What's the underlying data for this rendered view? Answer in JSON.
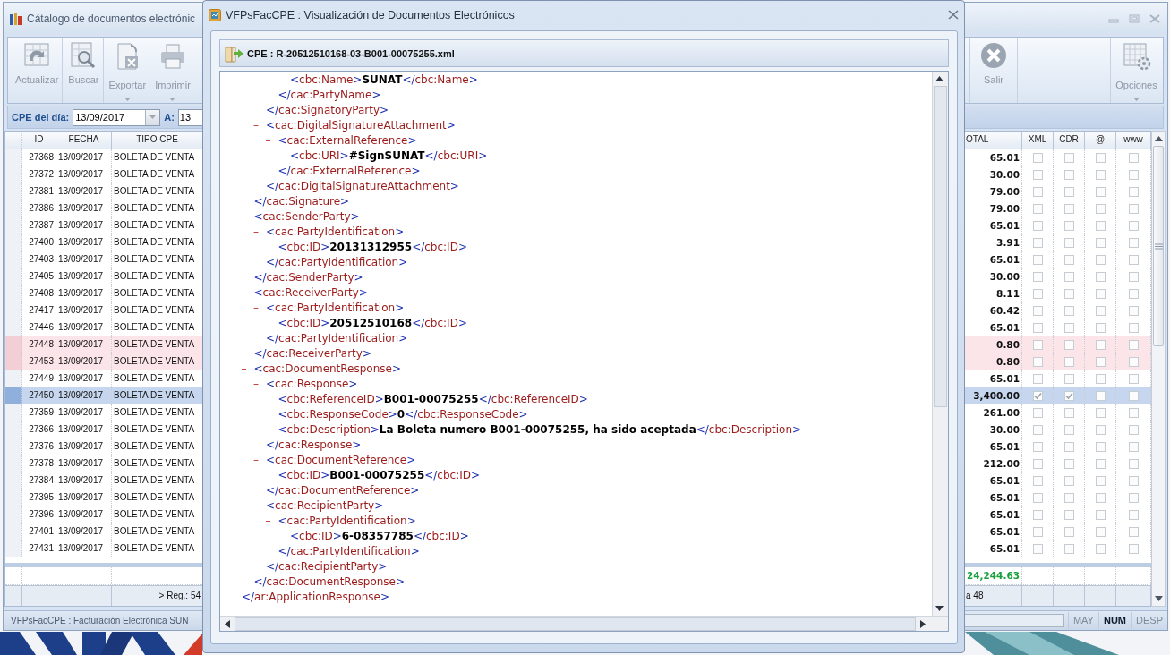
{
  "main_window": {
    "title": "Cátalogo de documentos electrónic",
    "toolbar_left": [
      {
        "label": "Actualizar",
        "kind": "refresh",
        "dropdown": false
      },
      {
        "label": "Buscar",
        "kind": "search",
        "dropdown": false
      },
      {
        "label": "Exportar",
        "kind": "export",
        "dropdown": true
      },
      {
        "label": "Imprimir",
        "kind": "print",
        "dropdown": true
      }
    ],
    "toolbar_right": [
      {
        "label": "Salir",
        "kind": "exit",
        "dropdown": false
      },
      {
        "label": "Opciones",
        "kind": "options",
        "dropdown": true
      }
    ],
    "filter": {
      "label": "CPE del día:",
      "date_from": "13/09/2017",
      "to_label": "A:",
      "date_to": "13"
    },
    "table": {
      "columns_left": [
        "ID",
        "FECHA",
        "TIPO CPE"
      ],
      "columns_right": [
        "OTAL",
        "XML",
        "CDR",
        "@",
        "www"
      ],
      "rows": [
        {
          "id": "27368",
          "date": "13/09/2017",
          "type": "BOLETA DE VENTA",
          "total": "65.01",
          "xml": false,
          "cdr": false,
          "email": false,
          "web": false,
          "selected": false,
          "flagged": false
        },
        {
          "id": "27372",
          "date": "13/09/2017",
          "type": "BOLETA DE VENTA",
          "total": "30.00",
          "xml": false,
          "cdr": false,
          "email": false,
          "web": false,
          "selected": false,
          "flagged": false
        },
        {
          "id": "27381",
          "date": "13/09/2017",
          "type": "BOLETA DE VENTA",
          "total": "79.00",
          "xml": false,
          "cdr": false,
          "email": false,
          "web": false,
          "selected": false,
          "flagged": false
        },
        {
          "id": "27386",
          "date": "13/09/2017",
          "type": "BOLETA DE VENTA",
          "total": "79.00",
          "xml": false,
          "cdr": false,
          "email": false,
          "web": false,
          "selected": false,
          "flagged": false
        },
        {
          "id": "27387",
          "date": "13/09/2017",
          "type": "BOLETA DE VENTA",
          "total": "65.01",
          "xml": false,
          "cdr": false,
          "email": false,
          "web": false,
          "selected": false,
          "flagged": false
        },
        {
          "id": "27400",
          "date": "13/09/2017",
          "type": "BOLETA DE VENTA",
          "total": "3.91",
          "xml": false,
          "cdr": false,
          "email": false,
          "web": false,
          "selected": false,
          "flagged": false
        },
        {
          "id": "27403",
          "date": "13/09/2017",
          "type": "BOLETA DE VENTA",
          "total": "65.01",
          "xml": false,
          "cdr": false,
          "email": false,
          "web": false,
          "selected": false,
          "flagged": false
        },
        {
          "id": "27405",
          "date": "13/09/2017",
          "type": "BOLETA DE VENTA",
          "total": "30.00",
          "xml": false,
          "cdr": false,
          "email": false,
          "web": false,
          "selected": false,
          "flagged": false
        },
        {
          "id": "27408",
          "date": "13/09/2017",
          "type": "BOLETA DE VENTA",
          "total": "8.11",
          "xml": false,
          "cdr": false,
          "email": false,
          "web": false,
          "selected": false,
          "flagged": false
        },
        {
          "id": "27417",
          "date": "13/09/2017",
          "type": "BOLETA DE VENTA",
          "total": "60.42",
          "xml": false,
          "cdr": false,
          "email": false,
          "web": false,
          "selected": false,
          "flagged": false
        },
        {
          "id": "27446",
          "date": "13/09/2017",
          "type": "BOLETA DE VENTA",
          "total": "65.01",
          "xml": false,
          "cdr": false,
          "email": false,
          "web": false,
          "selected": false,
          "flagged": false
        },
        {
          "id": "27448",
          "date": "13/09/2017",
          "type": "BOLETA DE VENTA",
          "total": "0.80",
          "xml": false,
          "cdr": false,
          "email": false,
          "web": false,
          "selected": false,
          "flagged": true
        },
        {
          "id": "27453",
          "date": "13/09/2017",
          "type": "BOLETA DE VENTA",
          "total": "0.80",
          "xml": false,
          "cdr": false,
          "email": false,
          "web": false,
          "selected": false,
          "flagged": true
        },
        {
          "id": "27449",
          "date": "13/09/2017",
          "type": "BOLETA DE VENTA",
          "total": "65.01",
          "xml": false,
          "cdr": false,
          "email": false,
          "web": false,
          "selected": false,
          "flagged": false
        },
        {
          "id": "27450",
          "date": "13/09/2017",
          "type": "BOLETA DE VENTA",
          "total": "3,400.00",
          "xml": true,
          "cdr": true,
          "email": false,
          "web": false,
          "selected": true,
          "flagged": false
        },
        {
          "id": "27359",
          "date": "13/09/2017",
          "type": "BOLETA DE VENTA",
          "total": "261.00",
          "xml": false,
          "cdr": false,
          "email": false,
          "web": false,
          "selected": false,
          "flagged": false
        },
        {
          "id": "27366",
          "date": "13/09/2017",
          "type": "BOLETA DE VENTA",
          "total": "30.00",
          "xml": false,
          "cdr": false,
          "email": false,
          "web": false,
          "selected": false,
          "flagged": false
        },
        {
          "id": "27376",
          "date": "13/09/2017",
          "type": "BOLETA DE VENTA",
          "total": "65.01",
          "xml": false,
          "cdr": false,
          "email": false,
          "web": false,
          "selected": false,
          "flagged": false
        },
        {
          "id": "27378",
          "date": "13/09/2017",
          "type": "BOLETA DE VENTA",
          "total": "212.00",
          "xml": false,
          "cdr": false,
          "email": false,
          "web": false,
          "selected": false,
          "flagged": false
        },
        {
          "id": "27384",
          "date": "13/09/2017",
          "type": "BOLETA DE VENTA",
          "total": "65.01",
          "xml": false,
          "cdr": false,
          "email": false,
          "web": false,
          "selected": false,
          "flagged": false
        },
        {
          "id": "27395",
          "date": "13/09/2017",
          "type": "BOLETA DE VENTA",
          "total": "65.01",
          "xml": false,
          "cdr": false,
          "email": false,
          "web": false,
          "selected": false,
          "flagged": false
        },
        {
          "id": "27396",
          "date": "13/09/2017",
          "type": "BOLETA DE VENTA",
          "total": "65.01",
          "xml": false,
          "cdr": false,
          "email": false,
          "web": false,
          "selected": false,
          "flagged": false
        },
        {
          "id": "27401",
          "date": "13/09/2017",
          "type": "BOLETA DE VENTA",
          "total": "65.01",
          "xml": false,
          "cdr": false,
          "email": false,
          "web": false,
          "selected": false,
          "flagged": false
        },
        {
          "id": "27431",
          "date": "13/09/2017",
          "type": "BOLETA DE VENTA",
          "total": "65.01",
          "xml": false,
          "cdr": false,
          "email": false,
          "web": false,
          "selected": false,
          "flagged": false
        }
      ],
      "sum_total": "24,244.63",
      "footer_records": "> Reg.: 54",
      "footer_right": "a 48"
    },
    "status_bar": {
      "text": "VFPsFacCPE : Facturación Electrónica SUN",
      "indicators": [
        {
          "label": "MAY",
          "on": false
        },
        {
          "label": "NUM",
          "on": true
        },
        {
          "label": "DESP",
          "on": false
        }
      ]
    }
  },
  "dialog": {
    "title": "VFPsFacCPE : Visualización de Documentos Electrónicos",
    "file": "CPE : R-20512510168-03-B001-00075255.xml",
    "xml": {
      "kind": "element",
      "close": "</ar:ApplicationResponse>",
      "children": [
        {
          "kind": "element",
          "close": "</cac:Signature>",
          "children": [
            {
              "kind": "element",
              "close": "</cac:SignatoryParty>",
              "children": [
                {
                  "kind": "element",
                  "close": "</cac:PartyName>",
                  "children": [
                    {
                      "kind": "leaf",
                      "open": "<cbc:Name>",
                      "value": "SUNAT",
                      "close": "</cbc:Name>"
                    }
                  ]
                }
              ]
            },
            {
              "kind": "element",
              "toggle": "–",
              "open": "<cac:DigitalSignatureAttachment>",
              "close": "</cac:DigitalSignatureAttachment>",
              "children": [
                {
                  "kind": "element",
                  "toggle": "–",
                  "open": "<cac:ExternalReference>",
                  "close": "</cac:ExternalReference>",
                  "children": [
                    {
                      "kind": "leaf",
                      "open": "<cbc:URI>",
                      "value": "#SignSUNAT",
                      "close": "</cbc:URI>"
                    }
                  ]
                }
              ]
            }
          ]
        },
        {
          "kind": "element",
          "toggle": "–",
          "open": "<cac:SenderParty>",
          "close": "</cac:SenderParty>",
          "children": [
            {
              "kind": "element",
              "toggle": "–",
              "open": "<cac:PartyIdentification>",
              "close": "</cac:PartyIdentification>",
              "children": [
                {
                  "kind": "leaf",
                  "open": "<cbc:ID>",
                  "value": "20131312955",
                  "close": "</cbc:ID>"
                }
              ]
            }
          ]
        },
        {
          "kind": "element",
          "toggle": "–",
          "open": "<cac:ReceiverParty>",
          "close": "</cac:ReceiverParty>",
          "children": [
            {
              "kind": "element",
              "toggle": "–",
              "open": "<cac:PartyIdentification>",
              "close": "</cac:PartyIdentification>",
              "children": [
                {
                  "kind": "leaf",
                  "open": "<cbc:ID>",
                  "value": "20512510168",
                  "close": "</cbc:ID>"
                }
              ]
            }
          ]
        },
        {
          "kind": "element",
          "toggle": "–",
          "open": "<cac:DocumentResponse>",
          "close": "</cac:DocumentResponse>",
          "children": [
            {
              "kind": "element",
              "toggle": "–",
              "open": "<cac:Response>",
              "close": "</cac:Response>",
              "children": [
                {
                  "kind": "leaf",
                  "open": "<cbc:ReferenceID>",
                  "value": "B001-00075255",
                  "close": "</cbc:ReferenceID>"
                },
                {
                  "kind": "leaf",
                  "open": "<cbc:ResponseCode>",
                  "value": "0",
                  "close": "</cbc:ResponseCode>"
                },
                {
                  "kind": "leaf",
                  "open": "<cbc:Description>",
                  "value": "La Boleta numero B001-00075255, ha sido aceptada",
                  "close": "</cbc:Description>"
                }
              ]
            },
            {
              "kind": "element",
              "toggle": "–",
              "open": "<cac:DocumentReference>",
              "close": "</cac:DocumentReference>",
              "children": [
                {
                  "kind": "leaf",
                  "open": "<cbc:ID>",
                  "value": "B001-00075255",
                  "close": "</cbc:ID>"
                }
              ]
            },
            {
              "kind": "element",
              "toggle": "–",
              "open": "<cac:RecipientParty>",
              "close": "</cac:RecipientParty>",
              "children": [
                {
                  "kind": "element",
                  "toggle": "–",
                  "open": "<cac:PartyIdentification>",
                  "close": "</cac:PartyIdentification>",
                  "children": [
                    {
                      "kind": "leaf",
                      "open": "<cbc:ID>",
                      "value": "6-08357785",
                      "close": "</cbc:ID>"
                    }
                  ]
                }
              ]
            }
          ]
        }
      ]
    }
  }
}
